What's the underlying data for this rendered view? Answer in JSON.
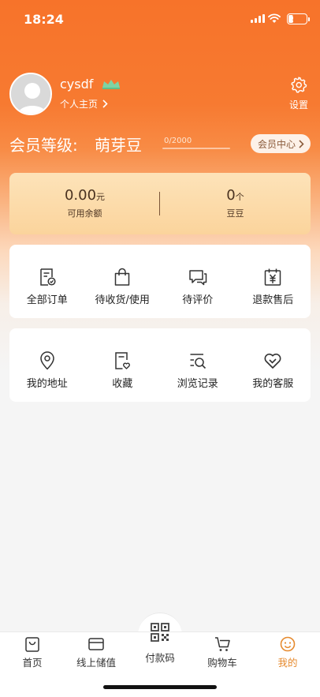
{
  "status_bar": {
    "time": "18:24",
    "battery": "29",
    "battery_level": 0.29
  },
  "profile": {
    "username": "cysdf",
    "homepage_link": "个人主页",
    "settings_label": "设置"
  },
  "membership": {
    "level_label": "会员等级:",
    "level_name": "萌芽豆",
    "progress_text": "0/2000",
    "progress_fraction": 0,
    "member_center_label": "会员中心"
  },
  "balance": {
    "available": {
      "value": "0.00",
      "unit": "元",
      "label": "可用余额"
    },
    "beans": {
      "value": "0",
      "unit": "个",
      "label": "豆豆"
    }
  },
  "orders_menu": [
    {
      "label": "全部订单",
      "icon": "order-list-icon"
    },
    {
      "label": "待收货/使用",
      "icon": "shopping-bag-icon"
    },
    {
      "label": "待评价",
      "icon": "comment-icon"
    },
    {
      "label": "退款售后",
      "icon": "refund-calendar-icon"
    }
  ],
  "services_menu": [
    {
      "label": "我的地址",
      "icon": "location-pin-icon"
    },
    {
      "label": "收藏",
      "icon": "favorite-icon"
    },
    {
      "label": "浏览记录",
      "icon": "browse-history-icon"
    },
    {
      "label": "我的客服",
      "icon": "customer-service-icon"
    }
  ],
  "tabbar": {
    "home": "首页",
    "online_topup": "线上储值",
    "pay_code": "付款码",
    "cart": "购物车",
    "mine": "我的"
  },
  "colors": {
    "primary": "#f7732a",
    "active_tab": "#e68a2e",
    "card_gold": "#fbd49c"
  }
}
